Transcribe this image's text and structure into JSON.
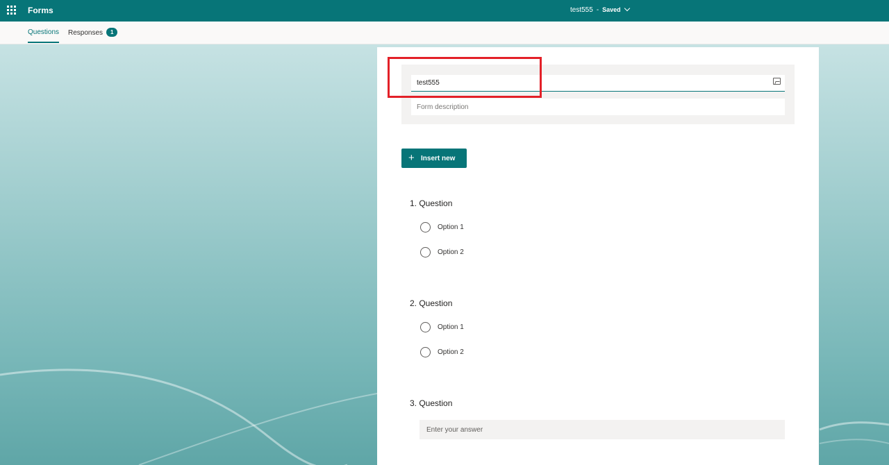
{
  "topbar": {
    "app_title": "Forms",
    "doc_title": "test555",
    "separator": "-",
    "status": "Saved"
  },
  "tabs": {
    "questions": "Questions",
    "responses": "Responses",
    "responses_count": "1"
  },
  "form": {
    "title_value": "test555",
    "description_placeholder": "Form description"
  },
  "insert_new_label": "Insert new",
  "questions": [
    {
      "number_title": "1. Question",
      "options": [
        "Option 1",
        "Option 2"
      ]
    },
    {
      "number_title": "2. Question",
      "options": [
        "Option 1",
        "Option 2"
      ]
    },
    {
      "number_title": "3. Question",
      "answer_placeholder": "Enter your answer"
    }
  ],
  "colors": {
    "accent": "#077578",
    "highlight": "#e32028"
  },
  "icons": [
    "app-launcher-icon",
    "chevron-down-icon",
    "insert-image-icon",
    "plus-icon",
    "radio-icon"
  ]
}
